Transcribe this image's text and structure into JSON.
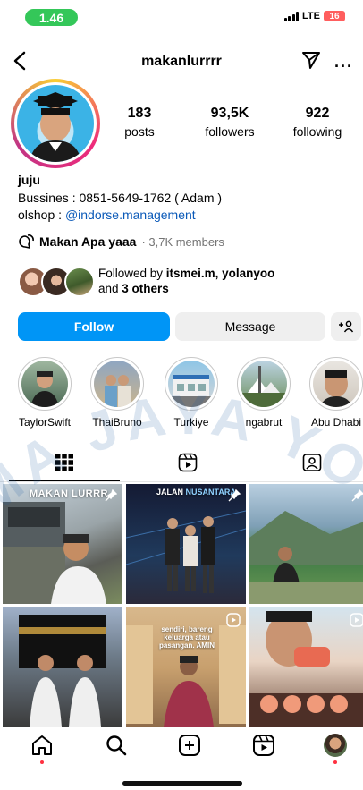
{
  "status_bar": {
    "time": "1.46",
    "network": "LTE",
    "battery": "16"
  },
  "header": {
    "username": "makanlurrrr"
  },
  "stats": [
    {
      "value": "183",
      "label": "posts"
    },
    {
      "value": "93,5K",
      "label": "followers"
    },
    {
      "value": "922",
      "label": "following"
    }
  ],
  "bio": {
    "name": "juju",
    "line1": "Bussines : 0851-5649-1762 ( Adam )",
    "line2_prefix": "olshop : ",
    "line2_link": "@indorse.management",
    "community_name": "Makan Apa yaaa",
    "community_members": "· 3,7K members"
  },
  "followed_by": {
    "prefix": "Followed by ",
    "names": "itsmei.m, yolanyoo",
    "and": "and ",
    "others": "3 others"
  },
  "buttons": {
    "follow": "Follow",
    "message": "Message",
    "add_user": "+♀"
  },
  "highlights": [
    {
      "label": "TaylorSwift"
    },
    {
      "label": "ThaiBruno"
    },
    {
      "label": "Turkiye"
    },
    {
      "label": "ngabrut"
    },
    {
      "label": "Abu Dhabi"
    }
  ],
  "grid": {
    "tile1_caption": "MAKAN LURRR",
    "tile2_caption_a": "JALAN",
    "tile2_caption_b": "NUSANTARA",
    "tile5_caption": "sendiri, bareng keluarga atau pasangan. AMIN"
  },
  "watermark": "MA JAYA YOGYA",
  "colors": {
    "accent": "#0095f6",
    "link": "#0a59b8",
    "notification": "#ff3040"
  }
}
